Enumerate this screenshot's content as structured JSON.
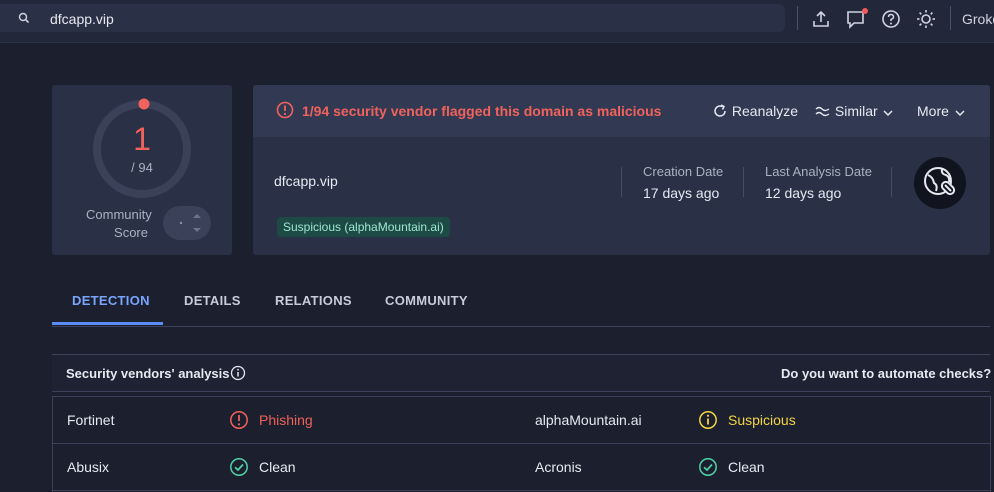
{
  "search": {
    "value": "dfcapp.vip",
    "icon": "search-icon"
  },
  "topbar": {
    "user_label": "Grokd",
    "notification_color": "#ef5a5a"
  },
  "score": {
    "detections": "1",
    "total": "/ 94",
    "community_label_line1": "Community",
    "community_label_line2": "Score",
    "ring_color": "#f0625b"
  },
  "alert": {
    "text": "1/94 security vendor flagged this domain as malicious",
    "reanalyze_label": "Reanalyze",
    "similar_label": "Similar",
    "more_label": "More"
  },
  "domain": {
    "name": "dfcapp.vip",
    "tag": "Suspicious (alphaMountain.ai)",
    "creation_label": "Creation Date",
    "creation_value": "17 days ago",
    "analysis_label": "Last Analysis Date",
    "analysis_value": "12 days ago"
  },
  "tabs": [
    {
      "label": "DETECTION",
      "active": true
    },
    {
      "label": "DETAILS",
      "active": false
    },
    {
      "label": "RELATIONS",
      "active": false
    },
    {
      "label": "COMMUNITY",
      "active": false
    }
  ],
  "vendors": {
    "title": "Security vendors' analysis",
    "automate_prompt": "Do you want to automate checks?",
    "rows": [
      [
        {
          "vendor": "Fortinet",
          "result": "Phishing",
          "status": "malicious",
          "color": "#f0625b"
        },
        {
          "vendor": "alphaMountain.ai",
          "result": "Suspicious",
          "status": "suspicious",
          "color": "#f5d442"
        }
      ],
      [
        {
          "vendor": "Abusix",
          "result": "Clean",
          "status": "clean",
          "color": "#e6e9f0"
        },
        {
          "vendor": "Acronis",
          "result": "Clean",
          "status": "clean",
          "color": "#e6e9f0"
        }
      ]
    ]
  }
}
